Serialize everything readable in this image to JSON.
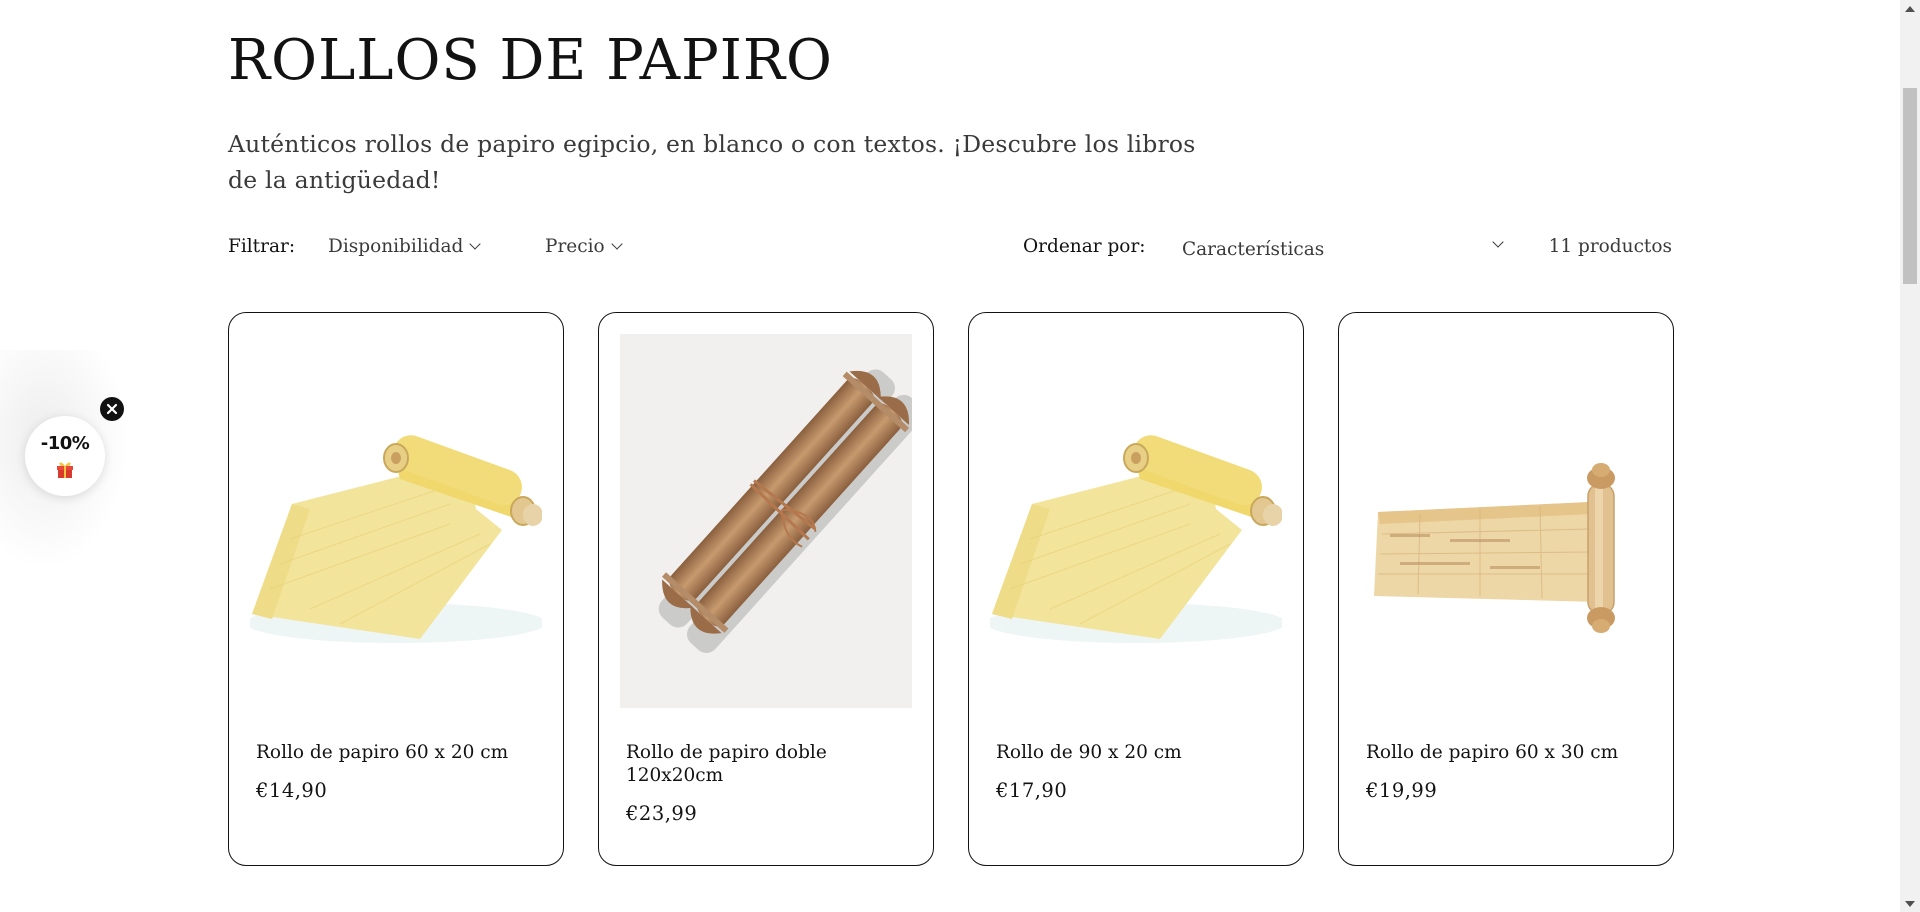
{
  "collection": {
    "title": "ROLLOS DE PAPIRO",
    "description": "Auténticos rollos de papiro egipcio, en blanco o con textos. ¡Descubre los libros de la antigüedad!"
  },
  "facets": {
    "filter_label": "Filtrar:",
    "filters": [
      {
        "label": "Disponibilidad"
      },
      {
        "label": "Precio"
      }
    ],
    "sort_label": "Ordenar por:",
    "sort_value": "Características",
    "product_count": "11 productos"
  },
  "products": [
    {
      "title": "Rollo de papiro 60 x 20 cm",
      "price": "€14,90",
      "image": "papyrus-roll-yellow"
    },
    {
      "title": "Rollo de papiro doble 120x20cm",
      "price": "€23,99",
      "image": "double-scroll-wooden"
    },
    {
      "title": "Rollo de 90 x 20 cm",
      "price": "€17,90",
      "image": "papyrus-roll-yellow"
    },
    {
      "title": "Rollo de papiro 60 x 30 cm",
      "price": "€19,99",
      "image": "papyrus-scroll-wooden-handle"
    }
  ],
  "promo": {
    "text": "-10%",
    "icon": "gift-icon",
    "close_icon": "close-icon"
  },
  "colors": {
    "text": "#121212",
    "border": "#121212",
    "papyrus": "#f0dd8a",
    "wood": "#a57a55"
  }
}
